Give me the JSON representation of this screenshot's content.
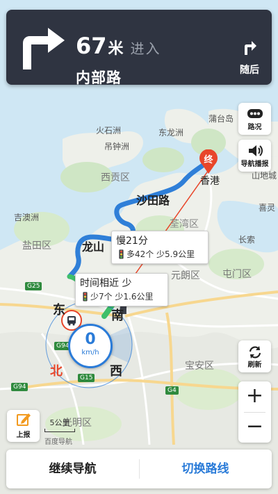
{
  "nav": {
    "distance": "67",
    "unit": "米",
    "action": "进入",
    "road": "内部路",
    "then_label": "随后"
  },
  "side": {
    "traffic": "路况",
    "broadcast": "导航播报",
    "refresh": "刷新",
    "zoom_in": "+",
    "zoom_out": "−",
    "report": "上报"
  },
  "routes": {
    "alt1_title": "慢21分",
    "alt1_detail": "多42个 少5.9公里",
    "alt2_title": "时间相近 少",
    "alt2_detail": "少7个 少1.6公里",
    "destination": "终"
  },
  "speed": {
    "value": "0",
    "unit": "km/h"
  },
  "compass": {
    "east": "东",
    "south": "南",
    "west": "西",
    "north": "北"
  },
  "map_labels": {
    "l1": "蒲台岛",
    "l2": "火石洲",
    "l3": "东龙洲",
    "l4": "吊钟洲",
    "l5": "西贡区",
    "l6": "沙田路",
    "l7": "香港",
    "l8": "山地城",
    "l9": "吉澳洲",
    "l10": "荃湾区",
    "l11": "喜灵",
    "l12": "盐田区",
    "l13": "龙山",
    "l14": "长索",
    "l15": "元朗区",
    "l16": "屯门区",
    "l17": "宝安区",
    "l18": "光明区",
    "shield_g25": "G25",
    "shield_g94": "G94",
    "shield_g94b": "G94",
    "shield_g15": "G15",
    "shield_g4": "G4"
  },
  "scale": {
    "text": "5公里",
    "logo": "百度导航"
  },
  "bottom": {
    "continue": "继续导航",
    "switch": "切换路线"
  },
  "colors": {
    "route_blue": "#2f7fd8",
    "panel": "#2f3441",
    "accent": "#2a7bd8",
    "dest_marker": "#e8462a"
  }
}
